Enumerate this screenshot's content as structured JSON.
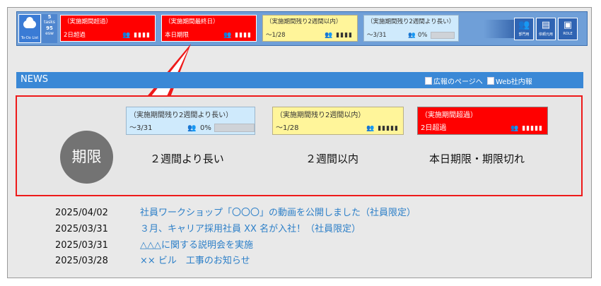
{
  "todo": {
    "label": "To-Do List",
    "tasks_count": "5",
    "tasks_label": "tasks",
    "total": "95",
    "total_label": "esw"
  },
  "topbar_cards": [
    {
      "title": "（実施期間超過）",
      "date": "2日超過",
      "color": "red"
    },
    {
      "title": "（実施期間最終日）",
      "date": "本日期限",
      "color": "red"
    },
    {
      "title": "（実施期間残り2週間以内）",
      "date": "～1/28",
      "color": "yellow"
    },
    {
      "title": "（実施期間残り2週間より長い）",
      "date": "～3/31",
      "percent": "0%",
      "progress": 0,
      "color": "blue"
    }
  ],
  "top_buttons": [
    {
      "label": "部門用",
      "icon": "group-icon"
    },
    {
      "label": "依頼元用",
      "icon": "document-icon"
    },
    {
      "label": "ROLE",
      "icon": "id-card-icon"
    }
  ],
  "news": {
    "title": "NEWS",
    "link_pr": "広報のページへ",
    "link_web": "Web社内報"
  },
  "legend": {
    "badge": "期限",
    "cards": [
      {
        "title": "（実施期間残り2週間より長い）",
        "date": "～3/31",
        "percent": "0%",
        "progress": 0,
        "caption": "２週間より長い"
      },
      {
        "title": "（実施期間残り2週間以内）",
        "date": "～1/28",
        "caption": "２週間以内"
      },
      {
        "title": "（実施期間超過）",
        "date": "2日超過",
        "caption": "本日期限・期限切れ"
      }
    ]
  },
  "news_items": [
    {
      "date": "2025/04/02",
      "text": "社員ワークショップ「〇〇〇」の動画を公開しました（社員限定）"
    },
    {
      "date": "2025/03/31",
      "text": "３月、キャリア採用社員 XX 名が入社！（社員限定）"
    },
    {
      "date": "2025/03/31",
      "text": "△△△に関する説明会を実施"
    },
    {
      "date": "2025/03/28",
      "text": "×× ビル　工事のお知らせ"
    }
  ],
  "colors": {
    "red": "#ff0000",
    "yellow": "#fff59a",
    "blue": "#cfeafc",
    "news_bar": "#3a88d6",
    "link": "#2c7fc8"
  }
}
